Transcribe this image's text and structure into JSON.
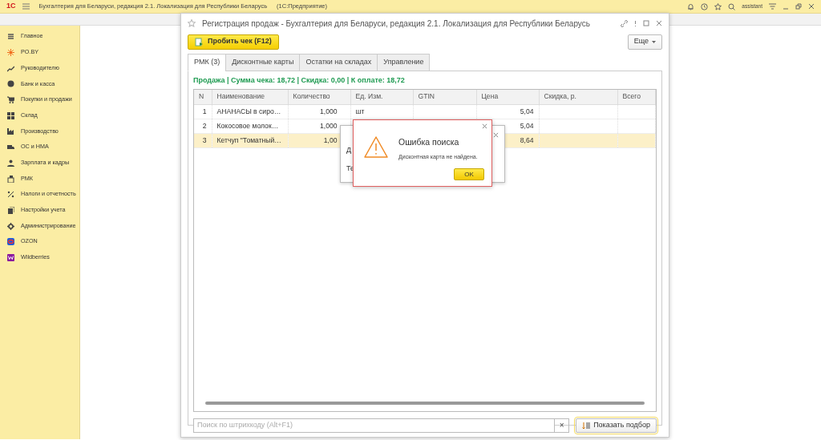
{
  "app_bar": {
    "logo": "1С",
    "title": "Бухгалтерия для Беларуси, редакция 2.1. Локализация для Республики Беларусь",
    "mode": "(1С:Предприятие)",
    "user": "assistant"
  },
  "sidebar": {
    "items": [
      {
        "label": "Главное"
      },
      {
        "label": "PO.BY"
      },
      {
        "label": "Руководителю"
      },
      {
        "label": "Банк и касса"
      },
      {
        "label": "Покупки и продажи"
      },
      {
        "label": "Склад"
      },
      {
        "label": "Производство"
      },
      {
        "label": "ОС и НМА"
      },
      {
        "label": "Зарплата и кадры"
      },
      {
        "label": "РМК"
      },
      {
        "label": "Налоги и отчетность"
      },
      {
        "label": "Настройки учета"
      },
      {
        "label": "Администрирование"
      },
      {
        "label": "OZON"
      },
      {
        "label": "Wildberries"
      }
    ]
  },
  "form": {
    "title": "Регистрация продаж - Бухгалтерия для Беларуси, редакция 2.1. Локализация для Республики Беларусь",
    "primary_button": "Пробить чек (F12)",
    "more_button": "Еще",
    "tabs": [
      {
        "label": "РМК (3)",
        "selected": true
      },
      {
        "label": "Дисконтные карты",
        "selected": false
      },
      {
        "label": "Остатки на складах",
        "selected": false
      },
      {
        "label": "Управление",
        "selected": false
      }
    ],
    "summary": "Продажа | Сумма чека: 18,72 | Скидка: 0,00 | К оплате: 18,72",
    "table": {
      "columns": [
        "N",
        "Наименование",
        "Количество",
        "Ед. Изм.",
        "GTIN",
        "Цена",
        "Скидка, р.",
        "Всего"
      ],
      "rows": [
        {
          "selected": false,
          "cells": [
            "1",
            "АНАНАСЫ в сиро…",
            "1,000",
            "шт",
            "",
            "5,04",
            "",
            ""
          ]
        },
        {
          "selected": false,
          "cells": [
            "2",
            "Кокосовое молок…",
            "1,000",
            "",
            "",
            "5,04",
            "",
            ""
          ]
        },
        {
          "selected": true,
          "cells": [
            "3",
            "Кетчуп \"Томатный…",
            "1,00",
            "",
            "",
            "8,64",
            "",
            ""
          ]
        }
      ]
    },
    "search": {
      "placeholder": "Поиск по штрихкоду (Alt+F1)",
      "clear_button": "×"
    },
    "pick_button": "Показать подбор"
  },
  "back_dialog": {
    "labels": [
      "Д",
      "Те"
    ]
  },
  "error_dialog": {
    "title": "Ошибка поиска",
    "message": "Дисконтная карта не найдена.",
    "button": "OK"
  }
}
